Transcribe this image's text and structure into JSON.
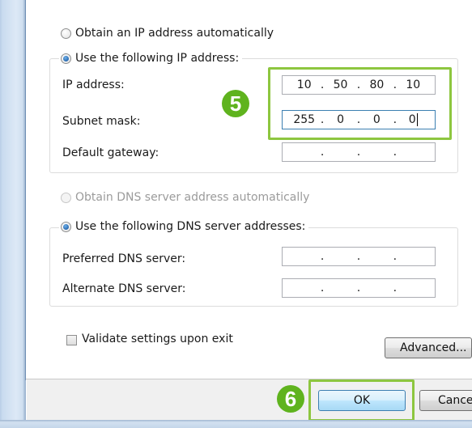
{
  "ip_section": {
    "obtain_auto_label": "Obtain an IP address automatically",
    "use_following_label": "Use the following IP address:",
    "ip_address_label": "IP address:",
    "ip_address": [
      "10",
      "50",
      "80",
      "10"
    ],
    "subnet_mask_label": "Subnet mask:",
    "subnet_mask": [
      "255",
      "0",
      "0",
      "0"
    ],
    "default_gateway_label": "Default gateway:",
    "default_gateway": [
      "",
      "",
      "",
      ""
    ]
  },
  "dns_section": {
    "obtain_auto_label": "Obtain DNS server address automatically",
    "use_following_label": "Use the following DNS server addresses:",
    "preferred_label": "Preferred DNS server:",
    "preferred": [
      "",
      "",
      "",
      ""
    ],
    "alternate_label": "Alternate DNS server:",
    "alternate": [
      "",
      "",
      "",
      ""
    ]
  },
  "validate_label": "Validate settings upon exit",
  "advanced_button": "Advanced...",
  "ok_button": "OK",
  "cancel_button": "Cancel",
  "annotations": {
    "step5": "5",
    "step6": "6",
    "highlight_color": "#8dc63f",
    "badge_color": "#5fb31e"
  }
}
